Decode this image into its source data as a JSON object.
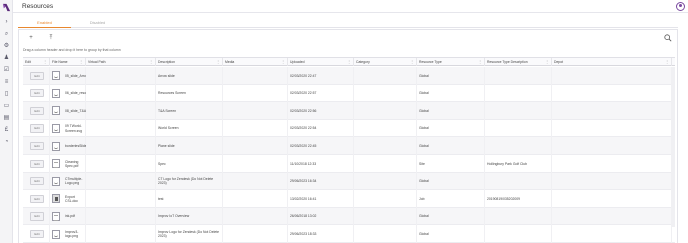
{
  "header": {
    "title": "Resources"
  },
  "tabs": [
    {
      "label": "Enabled"
    },
    {
      "label": "Disabled"
    }
  ],
  "toolbar": {
    "group_hint": "Drag a column header and drop it here to group by that column"
  },
  "columns": [
    "Edit",
    "File Name",
    "Virtual Path",
    "Description",
    "Media",
    "Uploaded",
    "Category",
    "Resource Type",
    "Resource Type Description",
    "Depot"
  ],
  "edit_label": "Edit",
  "rows": [
    {
      "thumb": "sign",
      "file": "05_slide_Arrow.svg",
      "path": "",
      "desc": "Arrow slide",
      "uploaded": "02/03/2020 22:47",
      "category": "",
      "type": "Global",
      "type_desc": "",
      "depot": ""
    },
    {
      "thumb": "sign",
      "file": "06_slide_resources_button.svg",
      "path": "",
      "desc": "Resources Screen",
      "uploaded": "02/03/2020 22:57",
      "category": "",
      "type": "Global",
      "type_desc": "",
      "depot": ""
    },
    {
      "thumb": "sign",
      "file": "08_slide_T&A.svg",
      "path": "",
      "desc": "T&A Screen",
      "uploaded": "02/03/2020 22:56",
      "category": "",
      "type": "Global",
      "type_desc": "",
      "depot": ""
    },
    {
      "thumb": "sign",
      "file": "09 TWorld-Screen.svg",
      "path": "",
      "desc": "World Screen",
      "uploaded": "02/03/2020 22:54",
      "category": "",
      "type": "Global",
      "type_desc": "",
      "depot": ""
    },
    {
      "thumb": "sign",
      "file": "borderlesSlide.svg",
      "path": "",
      "desc": "Plane slide",
      "uploaded": "02/03/2020 22:45",
      "category": "",
      "type": "Global",
      "type_desc": "",
      "depot": ""
    },
    {
      "thumb": "doc",
      "file": "Cleaning Spec.pdf",
      "path": "",
      "desc": "Spec",
      "uploaded": "11/10/2018 12:33",
      "category": "",
      "type": "Site",
      "type_desc": "Hollingbury Park Golf Club",
      "depot": ""
    },
    {
      "thumb": "sign",
      "file": "CTmultiple-Logo.png",
      "path": "",
      "desc": "CT Logo for Zendesk (Do Not Delete 2023)",
      "uploaded": "29/06/2023 16:34",
      "category": "",
      "type": "Global",
      "type_desc": "",
      "depot": ""
    },
    {
      "thumb": "dark",
      "file": "Export CSL.doc",
      "path": "",
      "desc": "test",
      "uploaded": "13/02/2020 16:41",
      "category": "",
      "type": "Job",
      "type_desc": "20190819/035202009",
      "depot": ""
    },
    {
      "thumb": "doc",
      "file": "ink.pdf",
      "path": "",
      "desc": "Improv IoT Overview",
      "uploaded": "26/06/2018 13:02",
      "category": "",
      "type": "Global",
      "type_desc": "",
      "depot": ""
    },
    {
      "thumb": "sign",
      "file": "Improv3-logo.png",
      "path": "",
      "desc": "Improv Logo for Zendesk (Do Not Delete 2023)",
      "uploaded": "29/06/2023 18:33",
      "category": "",
      "type": "Global",
      "type_desc": "",
      "depot": ""
    }
  ]
}
